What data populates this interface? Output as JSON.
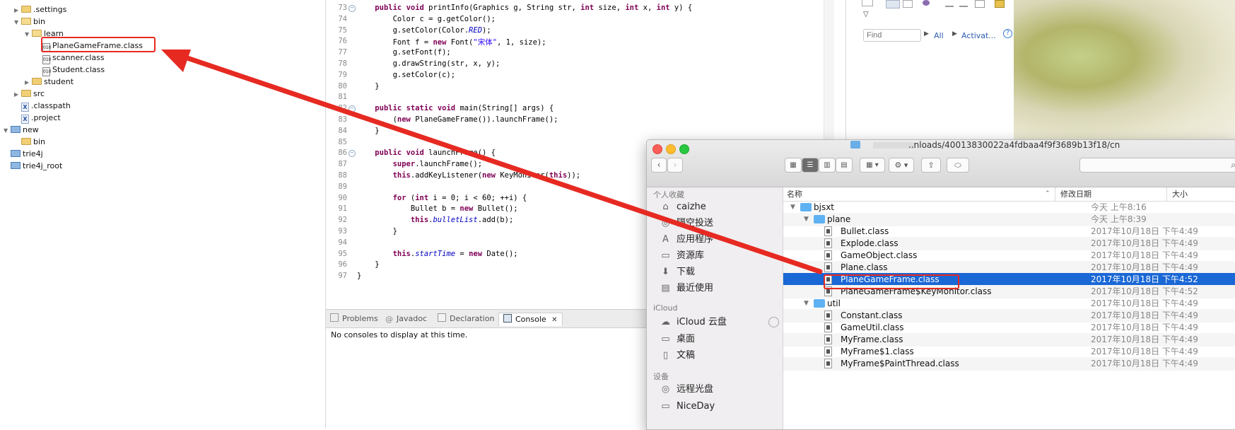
{
  "explorer": {
    "items": [
      {
        "label": ".settings",
        "type": "folder",
        "twisty": "▶"
      },
      {
        "label": "bin",
        "type": "folder-open",
        "twisty": "▼"
      },
      {
        "label": "learn",
        "type": "folder-open",
        "twisty": "▼"
      },
      {
        "label": "PlaneGameFrame.class",
        "type": "class",
        "twisty": ""
      },
      {
        "label": "scanner.class",
        "type": "class",
        "twisty": ""
      },
      {
        "label": "Student.class",
        "type": "class",
        "twisty": ""
      },
      {
        "label": "student",
        "type": "folder",
        "twisty": "▶"
      },
      {
        "label": "src",
        "type": "folder",
        "twisty": "▶"
      },
      {
        "label": ".classpath",
        "type": "xml",
        "twisty": ""
      },
      {
        "label": ".project",
        "type": "xml",
        "twisty": ""
      },
      {
        "label": "new",
        "type": "project",
        "twisty": "▼"
      },
      {
        "label": "bin",
        "type": "folder",
        "twisty": ""
      },
      {
        "label": "trie4j",
        "type": "project",
        "twisty": ""
      },
      {
        "label": "trie4j_root",
        "type": "project",
        "twisty": ""
      }
    ]
  },
  "editor": {
    "line_numbers": [
      "73",
      "74",
      "75",
      "76",
      "77",
      "78",
      "79",
      "80",
      "81",
      "82",
      "83",
      "84",
      "85",
      "86",
      "87",
      "88",
      "89",
      "90",
      "91",
      "92",
      "93",
      "94",
      "95",
      "96",
      "97"
    ],
    "lines": [
      [
        {
          "t": "    "
        },
        {
          "t": "public",
          "c": "kw"
        },
        {
          "t": " "
        },
        {
          "t": "void",
          "c": "kw"
        },
        {
          "t": " printInfo(Graphics g, String str, "
        },
        {
          "t": "int",
          "c": "kw"
        },
        {
          "t": " size, "
        },
        {
          "t": "int",
          "c": "kw"
        },
        {
          "t": " x, "
        },
        {
          "t": "int",
          "c": "kw"
        },
        {
          "t": " y) {"
        }
      ],
      [
        {
          "t": "        Color c = g.getColor();"
        }
      ],
      [
        {
          "t": "        g.setColor(Color."
        },
        {
          "t": "RED",
          "c": "fld"
        },
        {
          "t": ");"
        }
      ],
      [
        {
          "t": "        Font f = "
        },
        {
          "t": "new",
          "c": "kw"
        },
        {
          "t": " Font("
        },
        {
          "t": "\"宋体\"",
          "c": "str"
        },
        {
          "t": ", 1, size);"
        }
      ],
      [
        {
          "t": "        g.setFont(f);"
        }
      ],
      [
        {
          "t": "        g.drawString(str, x, y);"
        }
      ],
      [
        {
          "t": "        g.setColor(c);"
        }
      ],
      [
        {
          "t": "    }"
        }
      ],
      [
        {
          "t": ""
        }
      ],
      [
        {
          "t": "    "
        },
        {
          "t": "public",
          "c": "kw"
        },
        {
          "t": " "
        },
        {
          "t": "static",
          "c": "kw"
        },
        {
          "t": " "
        },
        {
          "t": "void",
          "c": "kw"
        },
        {
          "t": " main(String[] args) {"
        }
      ],
      [
        {
          "t": "        ("
        },
        {
          "t": "new",
          "c": "kw"
        },
        {
          "t": " PlaneGameFrame()).launchFrame();"
        }
      ],
      [
        {
          "t": "    }"
        }
      ],
      [
        {
          "t": ""
        }
      ],
      [
        {
          "t": "    "
        },
        {
          "t": "public",
          "c": "kw"
        },
        {
          "t": " "
        },
        {
          "t": "void",
          "c": "kw"
        },
        {
          "t": " launchFrame() {"
        }
      ],
      [
        {
          "t": "        "
        },
        {
          "t": "super",
          "c": "kw"
        },
        {
          "t": ".launchFrame();"
        }
      ],
      [
        {
          "t": "        "
        },
        {
          "t": "this",
          "c": "kw"
        },
        {
          "t": ".addKeyListener("
        },
        {
          "t": "new",
          "c": "kw"
        },
        {
          "t": " KeyMonitor("
        },
        {
          "t": "this",
          "c": "kw"
        },
        {
          "t": "));"
        }
      ],
      [
        {
          "t": ""
        }
      ],
      [
        {
          "t": "        "
        },
        {
          "t": "for",
          "c": "kw"
        },
        {
          "t": " ("
        },
        {
          "t": "int",
          "c": "kw"
        },
        {
          "t": " i = 0; i < 60; ++i) {"
        }
      ],
      [
        {
          "t": "            Bullet b = "
        },
        {
          "t": "new",
          "c": "kw"
        },
        {
          "t": " Bullet();"
        }
      ],
      [
        {
          "t": "            "
        },
        {
          "t": "this",
          "c": "kw"
        },
        {
          "t": "."
        },
        {
          "t": "bulletList",
          "c": "fld"
        },
        {
          "t": ".add(b);"
        }
      ],
      [
        {
          "t": "        }"
        }
      ],
      [
        {
          "t": ""
        }
      ],
      [
        {
          "t": "        "
        },
        {
          "t": "this",
          "c": "kw"
        },
        {
          "t": "."
        },
        {
          "t": "startTime",
          "c": "fld"
        },
        {
          "t": " = "
        },
        {
          "t": "new",
          "c": "kw"
        },
        {
          "t": " Date();"
        }
      ],
      [
        {
          "t": "    }"
        }
      ],
      [
        {
          "t": "}"
        }
      ]
    ]
  },
  "console": {
    "tabs": [
      {
        "label": "Problems",
        "active": false
      },
      {
        "label": "Javadoc",
        "active": false
      },
      {
        "label": "Declaration",
        "active": false
      },
      {
        "label": "Console",
        "active": true
      }
    ],
    "close_glyph": "✕",
    "message": "No consoles to display at this time."
  },
  "outline": {
    "find_placeholder": "Find",
    "all_label": "All",
    "activate_label": "Activat..."
  },
  "finder": {
    "path_title": "..nloads/40013830022a4fdbaa4f9f3689b13f18/cn",
    "sidebar": {
      "favorites_header": "个人收藏",
      "favorites": [
        {
          "label": "caizhe",
          "icon": "⌂"
        },
        {
          "label": "隔空投送",
          "icon": "◎"
        },
        {
          "label": "应用程序",
          "icon": "A"
        },
        {
          "label": "资源库",
          "icon": "▭"
        },
        {
          "label": "下载",
          "icon": "⬇"
        },
        {
          "label": "最近使用",
          "icon": "▤"
        }
      ],
      "icloud_header": "iCloud",
      "icloud": [
        {
          "label": "iCloud 云盘",
          "icon": "☁"
        },
        {
          "label": "桌面",
          "icon": "▭"
        },
        {
          "label": "文稿",
          "icon": "▯"
        }
      ],
      "devices_header": "设备",
      "devices": [
        {
          "label": "远程光盘",
          "icon": "◎"
        },
        {
          "label": "NiceDay",
          "icon": "▭"
        }
      ]
    },
    "columns": {
      "name": "名称",
      "date": "修改日期",
      "size": "大小"
    },
    "rows": [
      {
        "name": "bjsxt",
        "date": "今天 上午8:16",
        "kind": "folder",
        "level": 0,
        "twisty": "▼"
      },
      {
        "name": "plane",
        "date": "今天 上午8:39",
        "kind": "folder",
        "level": 1,
        "twisty": "▼"
      },
      {
        "name": "Bullet.class",
        "date": "2017年10月18日 下午4:49",
        "kind": "file",
        "level": 2,
        "twisty": ""
      },
      {
        "name": "Explode.class",
        "date": "2017年10月18日 下午4:49",
        "kind": "file",
        "level": 2,
        "twisty": ""
      },
      {
        "name": "GameObject.class",
        "date": "2017年10月18日 下午4:49",
        "kind": "file",
        "level": 2,
        "twisty": ""
      },
      {
        "name": "Plane.class",
        "date": "2017年10月18日 下午4:49",
        "kind": "file",
        "level": 2,
        "twisty": ""
      },
      {
        "name": "PlaneGameFrame.class",
        "date": "2017年10月18日 下午4:52",
        "kind": "file",
        "level": 2,
        "twisty": "",
        "selected": true
      },
      {
        "name": "PlaneGameFrame$KeyMonitor.class",
        "date": "2017年10月18日 下午4:52",
        "kind": "file",
        "level": 2,
        "twisty": ""
      },
      {
        "name": "util",
        "date": "2017年10月18日 下午4:49",
        "kind": "folder",
        "level": 1,
        "twisty": "▼"
      },
      {
        "name": "Constant.class",
        "date": "2017年10月18日 下午4:49",
        "kind": "file",
        "level": 2,
        "twisty": ""
      },
      {
        "name": "GameUtil.class",
        "date": "2017年10月18日 下午4:49",
        "kind": "file",
        "level": 2,
        "twisty": ""
      },
      {
        "name": "MyFrame.class",
        "date": "2017年10月18日 下午4:49",
        "kind": "file",
        "level": 2,
        "twisty": ""
      },
      {
        "name": "MyFrame$1.class",
        "date": "2017年10月18日 下午4:49",
        "kind": "file",
        "level": 2,
        "twisty": ""
      },
      {
        "name": "MyFrame$PaintThread.class",
        "date": "2017年10月18日 下午4:49",
        "kind": "file",
        "level": 2,
        "twisty": ""
      }
    ]
  },
  "annotation": {
    "color": "#e62a22"
  }
}
